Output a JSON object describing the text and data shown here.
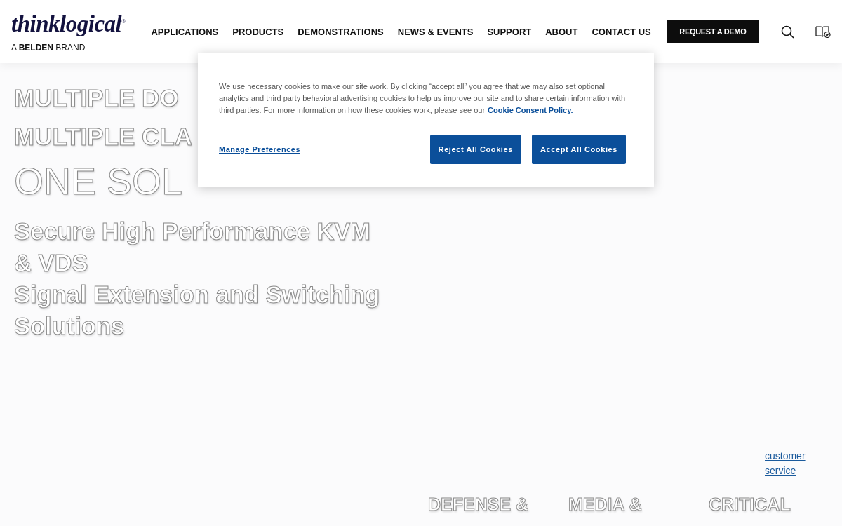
{
  "header": {
    "logo": {
      "name": "thinklogical",
      "mark": "®",
      "tagline": "A **BELDEN** BRAND"
    },
    "nav": [
      "APPLICATIONS",
      "PRODUCTS",
      "DEMONSTRATIONS",
      "NEWS & EVENTS",
      "SUPPORT",
      "ABOUT",
      "CONTACT US"
    ],
    "cta": "REQUEST A DEMO"
  },
  "hero": {
    "headings": [
      {
        "text": "MULTIPLE DO",
        "kind": "medium"
      },
      {
        "text": "MULTIPLE CLA",
        "kind": "medium"
      },
      {
        "text": "ONE SOL",
        "kind": "large"
      }
    ],
    "subtitle": [
      "Secure High Performance KVM & VDS",
      "Signal Extension and Switching Solutions"
    ]
  },
  "customer_service_link": "customer service",
  "markets": [
    "DEFENSE &",
    "MEDIA &",
    "CRITICAL"
  ],
  "cookie_banner": {
    "text": "We use necessary cookies to make our site work. By clicking “accept all” you agree that we may also set optional analytics and third party behavioral advertising cookies to help us improve our site and to share certain information with third parties. For more information on how these cookies work, please see our",
    "policy_link": "Cookie Consent Policy.",
    "manage_link": "Manage Preferences",
    "buttons": [
      "Reject All Cookies",
      "Accept All Cookies"
    ]
  }
}
